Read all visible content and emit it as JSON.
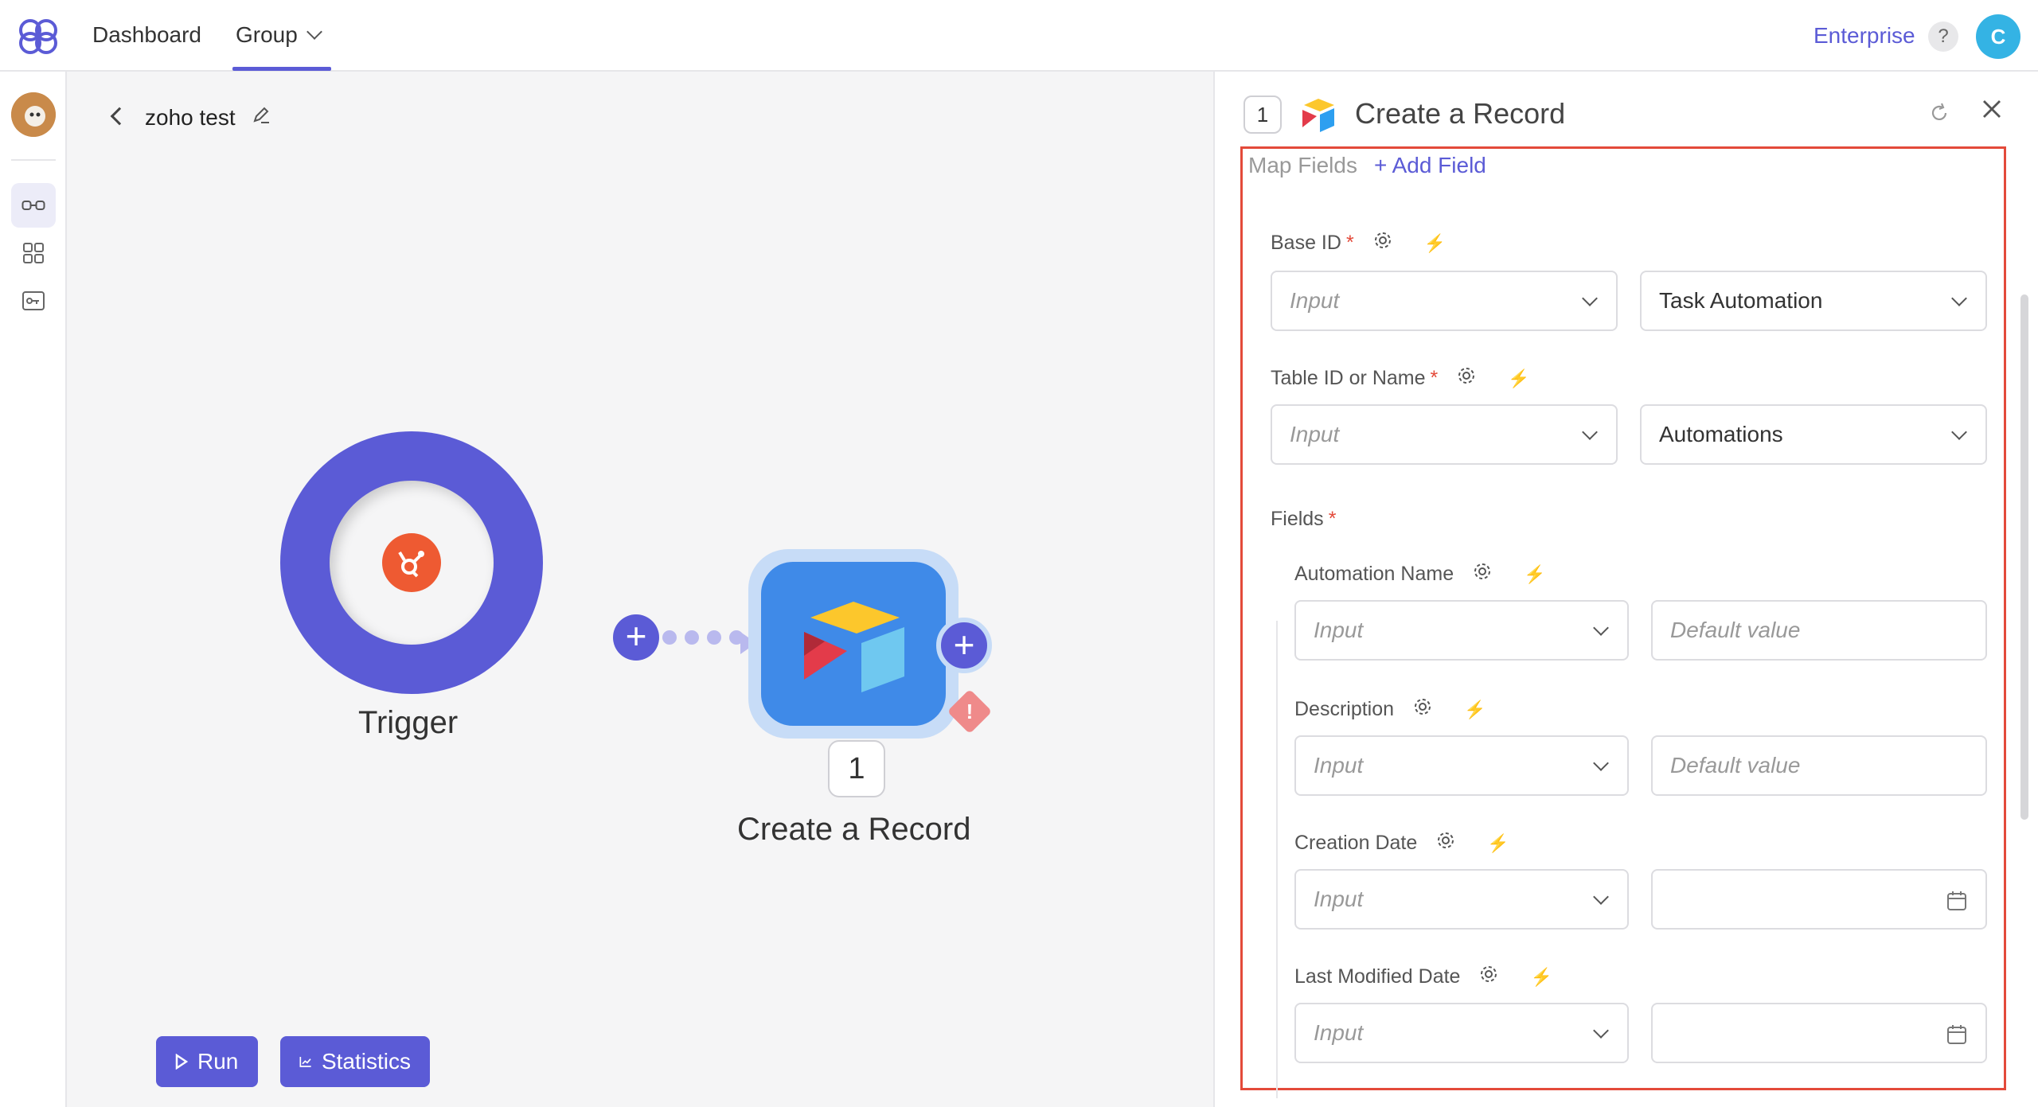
{
  "nav": {
    "dashboard": "Dashboard",
    "group": "Group",
    "enterprise": "Enterprise",
    "help": "?",
    "user_initial": "C"
  },
  "canvas": {
    "flow_title": "zoho test",
    "trigger_label": "Trigger",
    "node_step": "1",
    "node_label": "Create a Record",
    "warning": "!",
    "run_label": "Run",
    "stats_label": "Statistics"
  },
  "panel": {
    "step": "1",
    "title": "Create a Record",
    "map_fields": "Map Fields",
    "add_field": "+ Add Field",
    "base_id": {
      "label": "Base ID",
      "input": "Input",
      "value": "Task Automation"
    },
    "table_id": {
      "label": "Table ID or Name",
      "input": "Input",
      "value": "Automations"
    },
    "fields_label": "Fields",
    "fields": [
      {
        "label": "Automation Name",
        "input": "Input",
        "default": "Default value"
      },
      {
        "label": "Description",
        "input": "Input",
        "default": "Default value"
      },
      {
        "label": "Creation Date",
        "input": "Input",
        "default": ""
      },
      {
        "label": "Last Modified Date",
        "input": "Input",
        "default": ""
      }
    ],
    "required_mark": "*",
    "bolt": "⚡"
  },
  "colors": {
    "accent": "#5b5bd6",
    "highlight": "#e34a3a",
    "hubspot": "#ee5a32",
    "airtable_blue": "#3f8ae8"
  }
}
